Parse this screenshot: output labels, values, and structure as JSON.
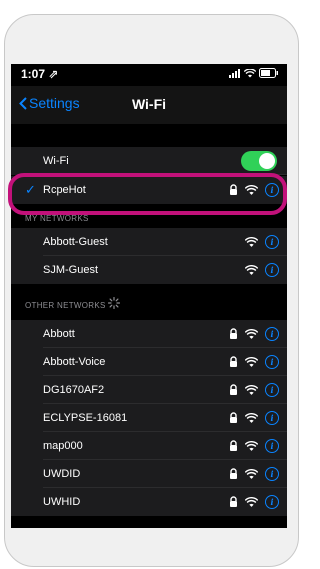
{
  "status_bar": {
    "time": "1:07 ⇗"
  },
  "nav": {
    "back_label": "Settings",
    "title": "Wi-Fi"
  },
  "wifi_row": {
    "label": "Wi-Fi",
    "enabled": true
  },
  "connected": {
    "name": "RcpeHot",
    "secured": true
  },
  "my_networks": {
    "header": "MY NETWORKS",
    "items": [
      {
        "name": "Abbott-Guest",
        "secured": false
      },
      {
        "name": "SJM-Guest",
        "secured": false
      }
    ]
  },
  "other_networks": {
    "header": "OTHER NETWORKS",
    "items": [
      {
        "name": "Abbott",
        "secured": true
      },
      {
        "name": "Abbott-Voice",
        "secured": true
      },
      {
        "name": "DG1670AF2",
        "secured": true
      },
      {
        "name": "ECLYPSE-16081",
        "secured": true
      },
      {
        "name": "map000",
        "secured": true
      },
      {
        "name": "UWDID",
        "secured": true
      },
      {
        "name": "UWHID",
        "secured": true
      }
    ]
  },
  "colors": {
    "accent": "#0a84ff",
    "toggle_on": "#30d158",
    "highlight": "#c2117a"
  },
  "icons": {
    "lock": "lock-icon",
    "wifi": "wifi-icon",
    "info": "info-icon"
  }
}
